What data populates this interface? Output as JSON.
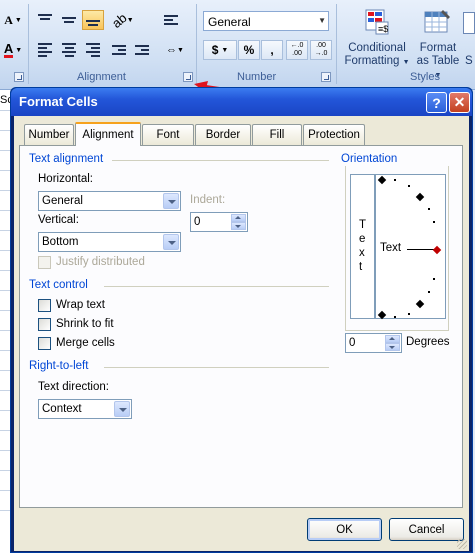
{
  "ribbon": {
    "alignment_group": "Alignment",
    "number_group": "Number",
    "styles_group": "Styles",
    "number_format": "General",
    "currency_symbol": "$",
    "percent_symbol": "%",
    "comma_symbol": ",",
    "inc_decimal": "←.0 .00",
    "dec_decimal": ".00 →.0",
    "conditional_formatting_line1": "Conditional",
    "conditional_formatting_line2": "Formatting",
    "format_table_line1": "Format",
    "format_table_line2": "as Table",
    "cut_off_label": "S",
    "font_size_glyph": "A",
    "font_color_glyph": "A",
    "left_edge_text": "Sc"
  },
  "dialog": {
    "title": "Format Cells",
    "help_glyph": "?",
    "close_glyph": "✕",
    "tabs": [
      "Number",
      "Alignment",
      "Font",
      "Border",
      "Fill",
      "Protection"
    ],
    "active_tab": "Alignment",
    "text_alignment": {
      "title": "Text alignment",
      "horizontal_label": "Horizontal:",
      "horizontal_value": "General",
      "indent_label": "Indent:",
      "indent_value": "0",
      "vertical_label": "Vertical:",
      "vertical_value": "Bottom",
      "justify_distributed": "Justify distributed"
    },
    "text_control": {
      "title": "Text control",
      "wrap_text": "Wrap text",
      "shrink_to_fit": "Shrink to fit",
      "merge_cells": "Merge cells"
    },
    "right_to_left": {
      "title": "Right-to-left",
      "direction_label": "Text direction:",
      "direction_value": "Context"
    },
    "orientation": {
      "title": "Orientation",
      "vertical_text_letters": [
        "T",
        "e",
        "x",
        "t"
      ],
      "dial_text": "Text",
      "degrees_value": "0",
      "degrees_label": "Degrees"
    },
    "ok_label": "OK",
    "cancel_label": "Cancel"
  },
  "colors": {
    "arrow": "#e0141e",
    "titlebar": "#2356d9",
    "section_title": "#0046d5",
    "dial_marker": "#c00000"
  }
}
